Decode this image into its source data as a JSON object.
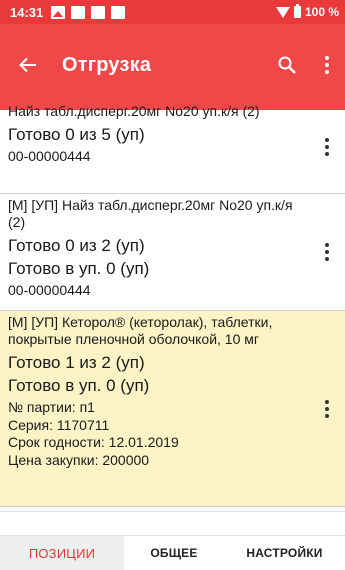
{
  "status_bar": {
    "time": "14:31",
    "battery": "100 %"
  },
  "app_bar": {
    "title": "Отгрузка",
    "icons": [
      "arrow-back-icon",
      "search-icon",
      "more-vert-icon"
    ]
  },
  "items": [
    {
      "name": "Найз табл.дисперг.20мг No20 уп.к/я (2)",
      "ready": "Готово 0 из 5 (уп)",
      "code": "00-00000444"
    },
    {
      "name": "[М] [УП] Найз табл.дисперг.20мг No20 уп.к/я (2)",
      "ready": "Готово 0 из 2 (уп)",
      "ready_pkg": "Готово в уп. 0 (уп)",
      "code": "00-00000444"
    },
    {
      "name": "[М] [УП] Кеторол® (кеторолак), таблетки, покрытые пленочной оболочкой, 10 мг",
      "ready": "Готово 1 из 2 (уп)",
      "ready_pkg": "Готово в уп. 0 (уп)",
      "batch": "№ партии: п1",
      "series": "Серия: 1170711",
      "expiry": "Срок годности: 12.01.2019",
      "price": "Цена закупки: 200000"
    }
  ],
  "tabs": [
    "ПОЗИЦИИ",
    "ОБЩЕЕ",
    "НАСТРОЙКИ"
  ],
  "colors": {
    "status_bar": "#e83a3a",
    "app_bar": "#f04848",
    "highlight": "#fcf4c6",
    "active_tab": "#e53935"
  }
}
